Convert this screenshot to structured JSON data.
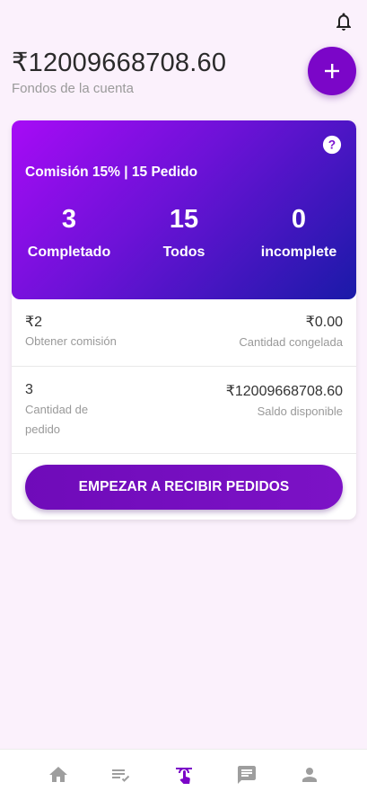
{
  "header": {
    "bell_icon": "bell-icon",
    "balance": "₹12009668708.60",
    "balance_label": "Fondos de la cuenta",
    "add_icon": "plus-icon"
  },
  "summary": {
    "help_icon": "question-circle-icon",
    "commission_text": "Comisión 15% | 15 Pedido",
    "stats": [
      {
        "value": "3",
        "label": "Completado"
      },
      {
        "value": "15",
        "label": "Todos"
      },
      {
        "value": "0",
        "label": "incomplete"
      }
    ]
  },
  "details": {
    "row1": {
      "left_value": "₹2",
      "left_label": "Obtener comisión",
      "right_value": "₹0.00",
      "right_label": "Cantidad congelada"
    },
    "row2": {
      "left_value": "3",
      "left_label": "Cantidad de pedido",
      "right_value": "₹12009668708.60",
      "right_label": "Saldo disponible"
    }
  },
  "cta_label": "EMPEZAR A RECIBIR PEDIDOS",
  "tabbar": {
    "items": [
      "home-icon",
      "list-check-icon",
      "touch-icon",
      "chat-icon",
      "person-icon"
    ],
    "active_index": 2,
    "active_color": "#7b06c8",
    "inactive_color": "#9e9e9e"
  },
  "colors": {
    "accent": "#7b06c8",
    "background": "#fbf1fc"
  }
}
